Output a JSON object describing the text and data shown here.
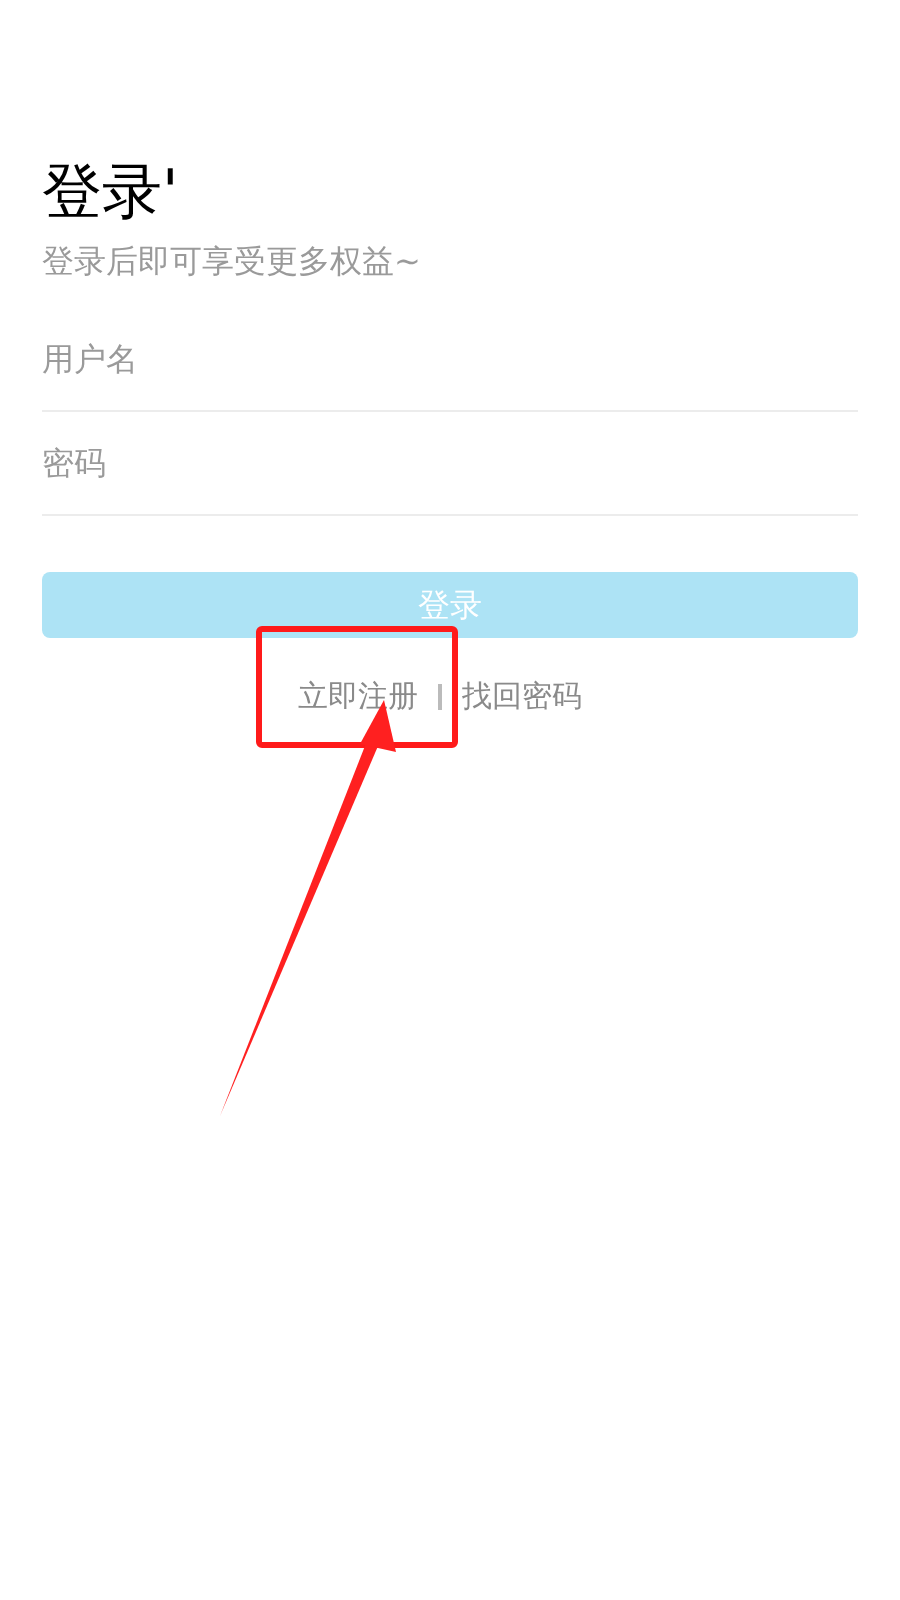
{
  "title": "登录'",
  "subtitle": "登录后即可享受更多权益~",
  "fields": [
    {
      "placeholder": "用户名"
    },
    {
      "placeholder": "密码"
    }
  ],
  "login_button": {
    "label": "登录",
    "disabled": true
  },
  "links": [
    {
      "label": "立即注册"
    },
    {
      "label": "找回密码"
    }
  ]
}
